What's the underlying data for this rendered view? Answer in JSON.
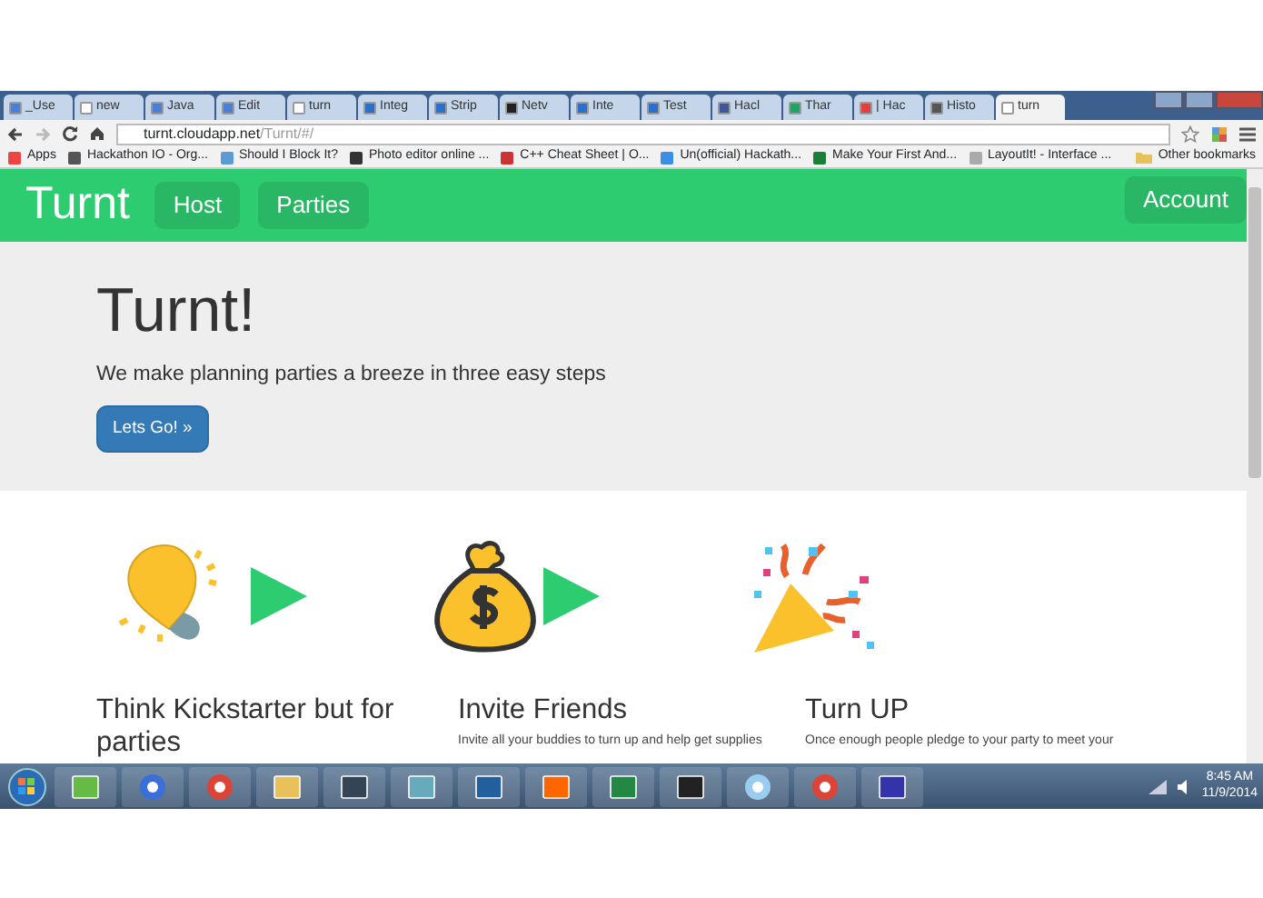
{
  "browser": {
    "tabs": [
      {
        "label": "_Use",
        "selected": false,
        "color": "#4a7fd4"
      },
      {
        "label": "new",
        "selected": false,
        "color": "#ffffff"
      },
      {
        "label": "Java",
        "selected": false,
        "color": "#4a7fd4"
      },
      {
        "label": "Edit",
        "selected": false,
        "color": "#4a7fd4"
      },
      {
        "label": "turn",
        "selected": false,
        "color": "#ffffff"
      },
      {
        "label": "Integ",
        "selected": false,
        "color": "#2a6fc9"
      },
      {
        "label": "Strip",
        "selected": false,
        "color": "#2a6fc9"
      },
      {
        "label": "Netv",
        "selected": false,
        "color": "#222222"
      },
      {
        "label": "Inte",
        "selected": false,
        "color": "#2a6fc9"
      },
      {
        "label": "Test",
        "selected": false,
        "color": "#2a6fc9"
      },
      {
        "label": "Hacl",
        "selected": false,
        "color": "#3b5998"
      },
      {
        "label": "Thar",
        "selected": false,
        "color": "#1fa463"
      },
      {
        "label": "| Hac",
        "selected": false,
        "color": "#e04040"
      },
      {
        "label": "Histo",
        "selected": false,
        "color": "#555555"
      },
      {
        "label": "turn",
        "selected": true,
        "color": "#ffffff"
      }
    ],
    "address": {
      "host": "turnt.cloudapp.net",
      "path": "/Turnt/#/"
    },
    "bookmarks": [
      "Apps",
      "Hackathon IO - Org...",
      "Should I Block It?",
      "Photo editor online ...",
      "C++ Cheat Sheet | O...",
      "Un(official) Hackath...",
      "Make Your First And...",
      "LayoutIt! - Interface ..."
    ],
    "other_bookmarks": "Other bookmarks"
  },
  "navbar": {
    "brand": "Turnt",
    "links": [
      {
        "label": "Host"
      },
      {
        "label": "Parties"
      }
    ],
    "account": "Account"
  },
  "hero": {
    "title": "Turnt!",
    "subtitle": "We make planning parties a breeze in three easy steps",
    "button": "Lets Go! »"
  },
  "features": [
    {
      "kind": "bulb",
      "title": "Think Kickstarter but for parties"
    },
    {
      "kind": "bag",
      "title": "Invite Friends",
      "text": "Invite all your buddies to turn up and help get supplies"
    },
    {
      "kind": "popper",
      "title": "Turn UP",
      "text": "Once enough people pledge to your party to meet your"
    }
  ],
  "taskbar": {
    "time": "8:45 AM",
    "date": "11/9/2014"
  }
}
